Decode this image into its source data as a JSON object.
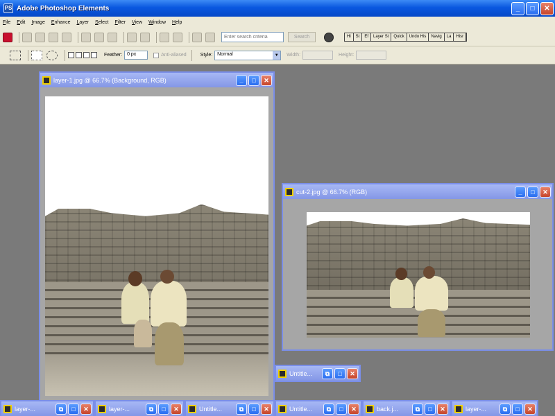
{
  "app": {
    "title": "Adobe Photoshop Elements"
  },
  "window_controls": {
    "minimize": "_",
    "maximize": "□",
    "close": "✕",
    "restore": "⧉"
  },
  "menu": [
    "File",
    "Edit",
    "Image",
    "Enhance",
    "Layer",
    "Select",
    "Filter",
    "View",
    "Window",
    "Help"
  ],
  "shortcuts": {
    "search_placeholder": "Enter search criteria",
    "search_button": "Search",
    "palette_tabs": [
      "Hi",
      "St",
      "Ef",
      "Layer St",
      "Quick",
      "Undo His",
      "Navig",
      "La",
      "Hisr"
    ]
  },
  "options": {
    "feather_label": "Feather:",
    "feather_value": "0 px",
    "antialiased_label": "Anti-aliased",
    "style_label": "Style:",
    "style_value": "Normal",
    "width_label": "Width:",
    "height_label": "Height:"
  },
  "documents": {
    "layer1": {
      "title": "layer-1.jpg @ 66.7% (Background, RGB)"
    },
    "cut2": {
      "title": "cut-2.jpg @ 66.7% (RGB)"
    }
  },
  "minimized": [
    {
      "title": "Untitle..."
    },
    {
      "title": "layer-..."
    },
    {
      "title": "layer-..."
    },
    {
      "title": "Untitle..."
    },
    {
      "title": "Untitle..."
    },
    {
      "title": "back.j..."
    },
    {
      "title": "layer-..."
    }
  ],
  "colors": {
    "titlebar": "#0a58e0",
    "doc_titlebar": "#8497e6",
    "workspace": "#7a7a7a",
    "chrome": "#ece9d8"
  }
}
